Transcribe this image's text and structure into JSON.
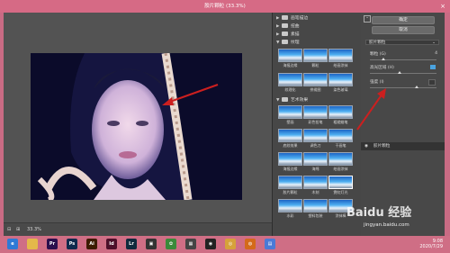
{
  "window": {
    "title": "胶片颗粒 (33.3%)"
  },
  "preview": {
    "zoom_value": "33.3%",
    "zoom_minus": "⊟",
    "zoom_plus": "⊞"
  },
  "gallery": {
    "categories": [
      {
        "label": "画笔描边",
        "expanded": false
      },
      {
        "label": "扭曲",
        "expanded": false
      },
      {
        "label": "素描",
        "expanded": false
      },
      {
        "label": "纹理",
        "expanded": false
      },
      {
        "label": "艺术效果",
        "expanded": true
      }
    ],
    "top_thumbs": [
      "海报边缘",
      "颗粒",
      "绘画涂抹",
      "纹理化",
      "拼缀图",
      "染色玻璃"
    ],
    "art_thumbs": [
      "壁画",
      "彩色铅笔",
      "粗糙蜡笔",
      "底纹效果",
      "调色刀",
      "干画笔",
      "海报边缘",
      "海绵",
      "绘画涂抹",
      "胶片颗粒",
      "木刻",
      "霓虹灯光",
      "水彩",
      "塑料包装",
      "涂抹棒"
    ],
    "selected_thumb": "胶片颗粒"
  },
  "settings": {
    "ok_label": "确定",
    "cancel_label": "取消",
    "filter_select": "胶片颗粒",
    "params": [
      {
        "label": "颗粒 (G)",
        "value": "4",
        "fraction": 0.2
      },
      {
        "label": "高光区域 (H)",
        "value": "",
        "fraction": 0.45
      },
      {
        "label": "强度 (I)",
        "value": "",
        "fraction": 0.7
      }
    ],
    "layer_label": "胶片颗粒"
  },
  "taskbar": {
    "icons": [
      {
        "name": "edge-icon",
        "text": "e",
        "color": "#2f7ad6"
      },
      {
        "name": "folder-icon",
        "text": "",
        "color": "#e4b84a"
      },
      {
        "name": "premiere-icon",
        "text": "Pr",
        "color": "#2a0f4d"
      },
      {
        "name": "photoshop-icon",
        "text": "Ps",
        "color": "#0f2a4d"
      },
      {
        "name": "illustrator-icon",
        "text": "Ai",
        "color": "#3d1b00"
      },
      {
        "name": "indesign-icon",
        "text": "Id",
        "color": "#4d0f2a"
      },
      {
        "name": "lightroom-icon",
        "text": "Lr",
        "color": "#0f2a3d"
      },
      {
        "name": "media-icon",
        "text": "▣",
        "color": "#333333"
      },
      {
        "name": "color-app-icon",
        "text": "✿",
        "color": "#3a8a3a"
      },
      {
        "name": "store-icon",
        "text": "▦",
        "color": "#444444"
      },
      {
        "name": "qq-icon",
        "text": "◉",
        "color": "#222222"
      },
      {
        "name": "chrome-icon",
        "text": "◎",
        "color": "#d6a23a"
      },
      {
        "name": "firefox-icon",
        "text": "◍",
        "color": "#d46a1a"
      },
      {
        "name": "notes-icon",
        "text": "▤",
        "color": "#4a7ad6"
      }
    ],
    "time": "9:08",
    "date": "2020/7/29"
  },
  "watermark": {
    "brand": "Baidu 经验",
    "url": "jingyan.baidu.com"
  },
  "colors": {
    "titlebar": "#d66a85",
    "arrow": "#cc1f1f",
    "panel": "#484848"
  }
}
